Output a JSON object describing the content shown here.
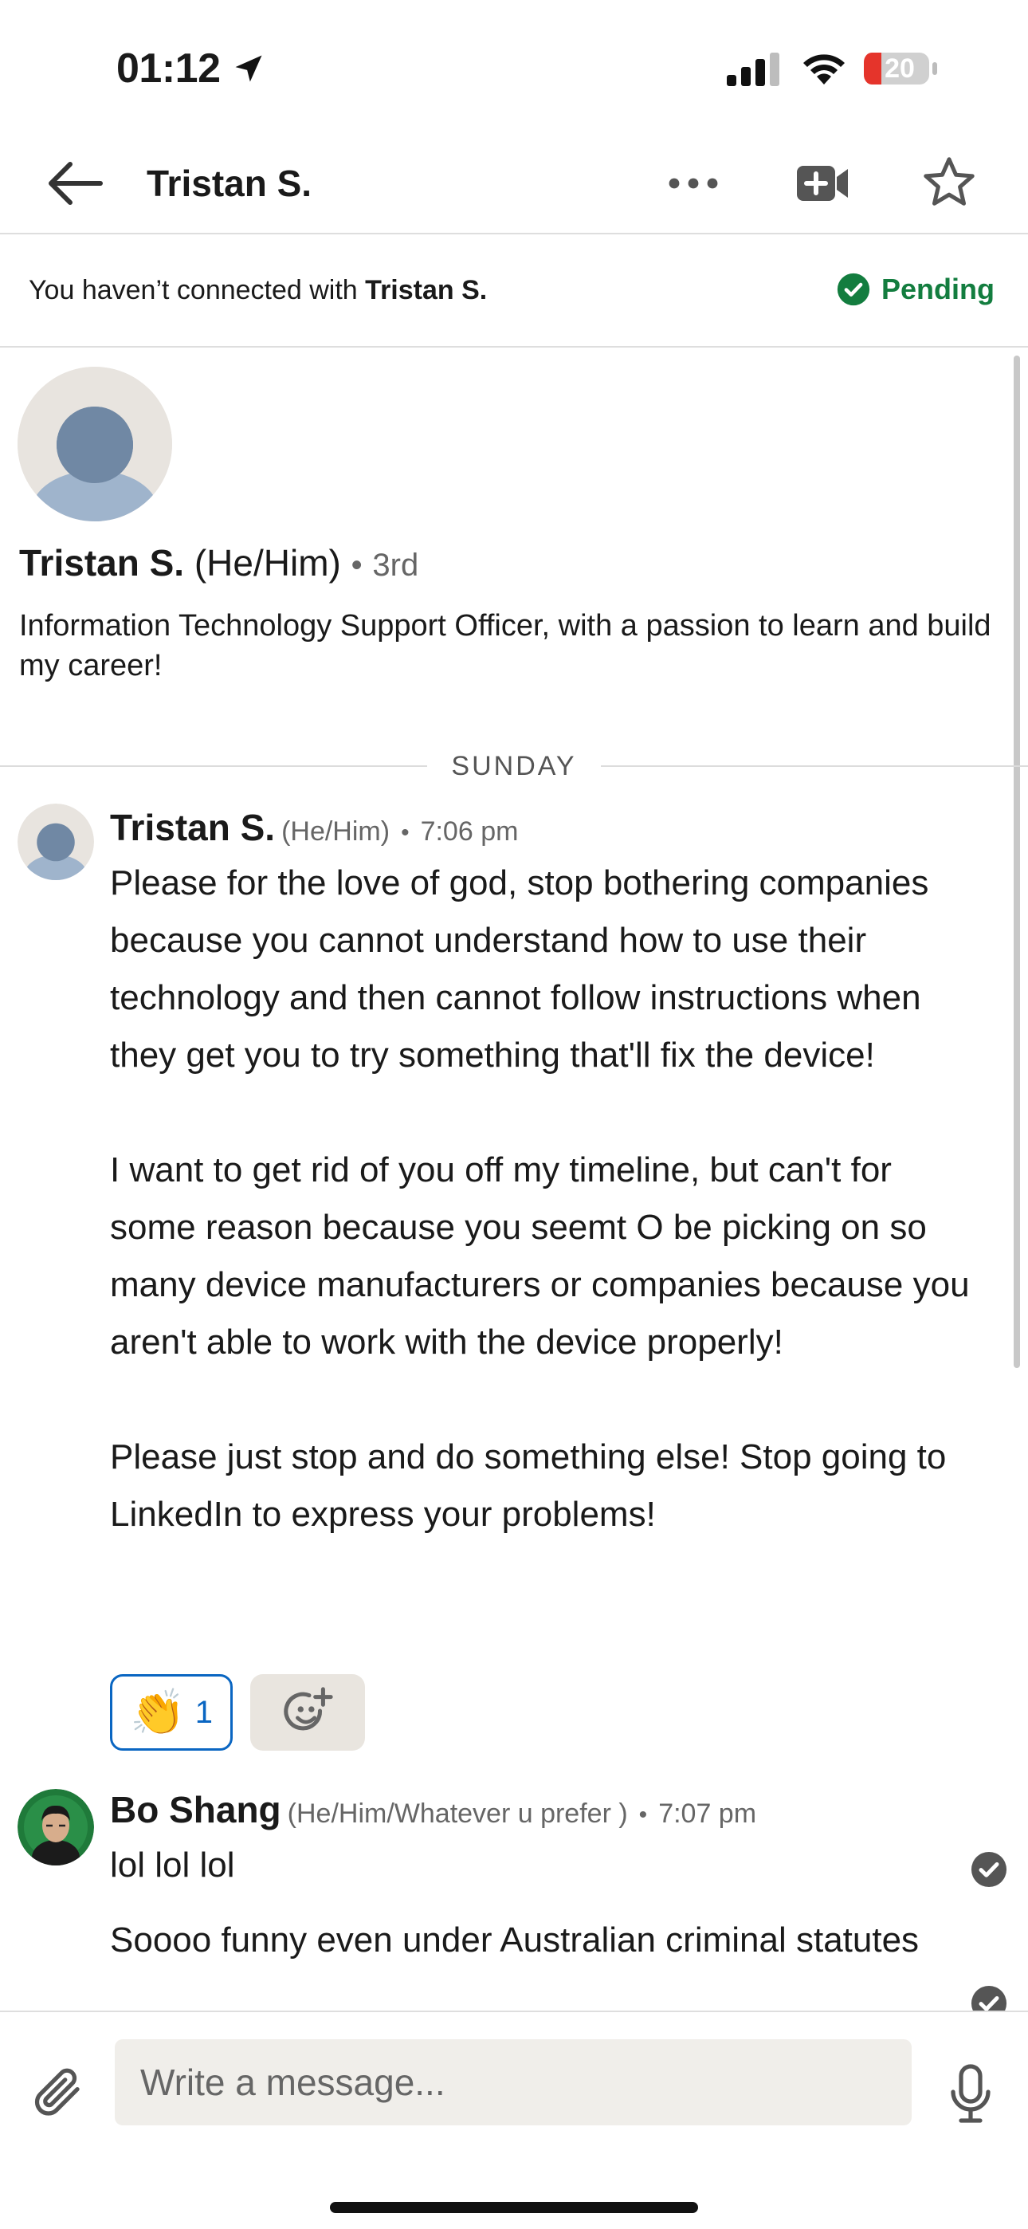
{
  "status_bar": {
    "time": "01:12",
    "battery": "20",
    "icons": [
      "location-arrow-icon",
      "signal-icon",
      "wifi-icon",
      "battery-icon"
    ]
  },
  "header": {
    "title": "Tristan S.",
    "icons": [
      "back-arrow-icon",
      "more-dots-icon",
      "video-call-icon",
      "star-icon"
    ]
  },
  "banner": {
    "prefix": "You haven’t connected with ",
    "name": "Tristan S.",
    "status": "Pending",
    "status_color": "#137d3f"
  },
  "profile": {
    "name": "Tristan S.",
    "pronouns": "(He/Him)",
    "separator": "•",
    "degree": "3rd",
    "headline": "Information Technology Support Officer, with a passion to learn and build my career!"
  },
  "divider": {
    "label": "SUNDAY"
  },
  "messages": [
    {
      "sender": "Tristan S.",
      "pronouns": "(He/Him)",
      "separator": "•",
      "time": "7:06 pm",
      "paragraphs": [
        "Please for the love of god, stop bothering companies because you cannot understand how to use their technology and then cannot follow instructions when they get you to try something that'll fix the device!",
        "I want to get rid of you off my timeline, but can't for some reason because you seemt O be picking on so many device manufacturers or companies because you aren't able to work with the device properly!",
        "Please just stop and do something else! Stop going to LinkedIn to express your problems!"
      ],
      "reaction": {
        "emoji": "👏",
        "count": "1"
      }
    },
    {
      "sender": "Bo Shang",
      "pronouns": "(He/Him/Whatever u prefer )",
      "separator": "•",
      "time": "7:07 pm",
      "lines": [
        "lol lol lol",
        "Soooo funny even under Australian criminal statutes"
      ]
    }
  ],
  "composer": {
    "placeholder": "Write a message..."
  },
  "colors": {
    "accent_blue": "#0a66c2",
    "pending_green": "#137d3f",
    "battery_red": "#e5342b"
  }
}
